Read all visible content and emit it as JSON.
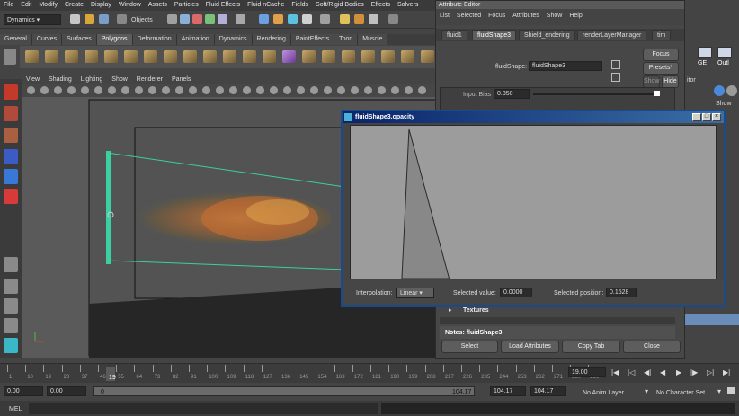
{
  "main_menu": [
    "File",
    "Edit",
    "Modify",
    "Create",
    "Display",
    "Window",
    "Assets",
    "Particles",
    "Fluid Effects",
    "Fluid nCache",
    "Fields",
    "Soft/Rigid Bodies",
    "Effects",
    "Solvers"
  ],
  "status": {
    "menu_set": "Dynamics",
    "objects_label": "Objects"
  },
  "shelf_tabs": [
    "General",
    "Curves",
    "Surfaces",
    "Polygons",
    "Deformation",
    "Animation",
    "Dynamics",
    "Rendering",
    "PaintEffects",
    "Toon",
    "Muscle"
  ],
  "shelf_active": "Polygons",
  "viewport_menu": [
    "View",
    "Shading",
    "Lighting",
    "Show",
    "Renderer",
    "Panels"
  ],
  "attribute_editor": {
    "title": "Attribute Editor",
    "menu": [
      "List",
      "Selected",
      "Focus",
      "Attributes",
      "Show",
      "Help"
    ],
    "tabs": [
      "fluid1",
      "fluidShape3",
      "Shield_endering",
      "renderLayerManager",
      "tim"
    ],
    "active_tab": "fluidShape3",
    "shape_label": "fluidShape:",
    "shape_value": "fluidShape3",
    "focus_label": "Focus",
    "presets_label": "Presets*",
    "show_label": "Show",
    "hide_label": "Hide",
    "input_bias_label": "Input Bias",
    "input_bias_value": "0.350",
    "textures_label": "Textures",
    "notes_label": "Notes: fluidShape3",
    "buttons": {
      "select": "Select",
      "load": "Load Attributes",
      "copy": "Copy Tab",
      "close": "Close"
    }
  },
  "right_panel": {
    "ge": "GE",
    "out": "Outl",
    "editor": "itor",
    "show": "Show"
  },
  "ramp_editor": {
    "title": "fluidShape3.opacity",
    "interp_label": "Interpolation:",
    "interp_value": "Linear",
    "sel_value_label": "Selected value:",
    "sel_value": "0.0000",
    "sel_pos_label": "Selected position:",
    "sel_pos": "0.1528",
    "ramp": {
      "peak_position": 0.16,
      "peak_value": 1.0,
      "zero_position": 0.27
    }
  },
  "timeline": {
    "ticks": [
      "1",
      "10",
      "19",
      "28",
      "37",
      "46",
      "55",
      "64",
      "73",
      "82",
      "91",
      "100",
      "109",
      "118",
      "127",
      "136",
      "145",
      "154",
      "163",
      "172",
      "181",
      "190",
      "199",
      "208",
      "217",
      "226",
      "235",
      "244",
      "253",
      "262",
      "271",
      "280",
      "289"
    ],
    "current_frame_label": "19",
    "current_time": "19.00"
  },
  "range": {
    "start": "0.00",
    "anim_start": "0.00",
    "slider_start": "0",
    "slider_end": "104.17",
    "end": "104.17",
    "anim_end": "104.17",
    "anim_layer": "No Anim Layer",
    "char_set": "No Character Set"
  },
  "mel_label": "MEL"
}
